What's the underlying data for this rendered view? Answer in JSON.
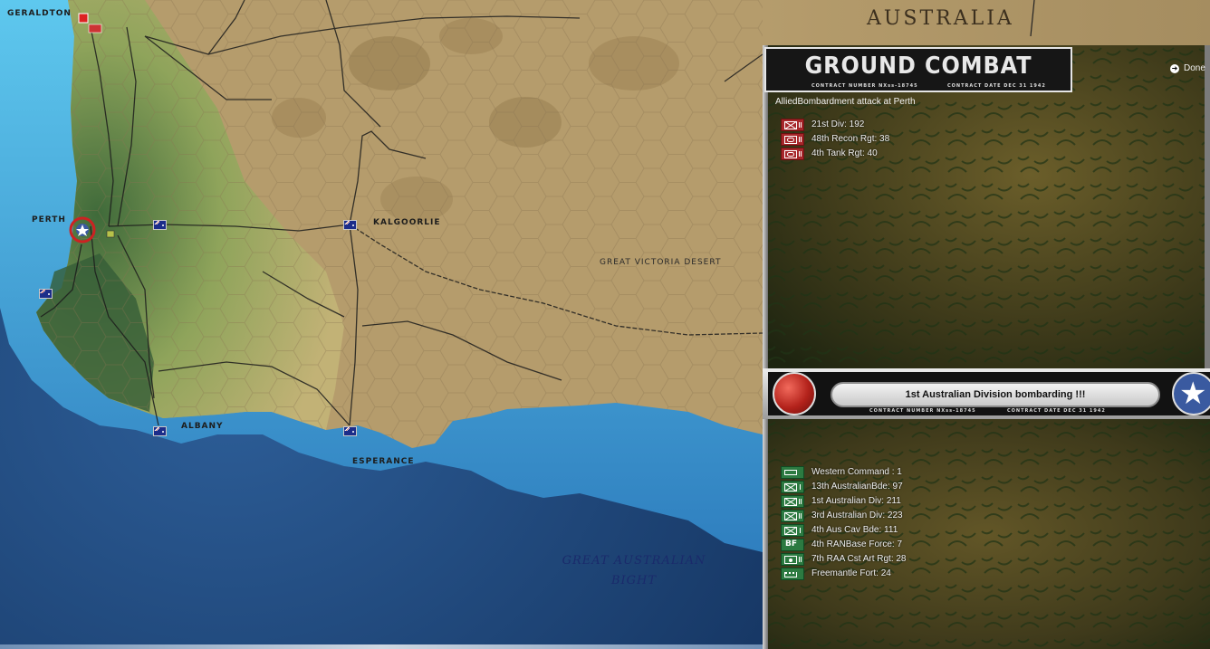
{
  "map": {
    "region_label": "AUSTRALIA",
    "places": {
      "geraldton": "GERALDTON",
      "perth": "PERTH",
      "kalgoorlie": "KALGOORLIE",
      "albany": "ALBANY",
      "esperance": "ESPERANCE",
      "desert": "GREAT VICTORIA DESERT"
    },
    "sea": {
      "line1": "GREAT AUSTRALIAN",
      "line2": "BIGHT"
    }
  },
  "combat_panel": {
    "title": "GROUND COMBAT",
    "contract_number": "CONTRACT NUMBER   NXss-18745",
    "contract_date": "CONTRACT DATE   DEC 31 1942",
    "done_label": "Done",
    "attack_text": "AlliedBombardment attack at Perth",
    "japanese_units": [
      {
        "icon": "infantry-division-icon",
        "label": "21st Div: 192"
      },
      {
        "icon": "recon-regiment-icon",
        "label": "48th Recon Rgt: 38"
      },
      {
        "icon": "tank-regiment-icon",
        "label": "4th Tank Rgt: 40"
      }
    ]
  },
  "result_panel": {
    "message": "1st Australian Division bombarding !!!",
    "contract_number": "CONTRACT NUMBER   NXss-18745",
    "contract_date": "CONTRACT DATE   DEC 31 1942",
    "allied_units": [
      {
        "icon": "hq-command-icon",
        "label": "Western Command : 1"
      },
      {
        "icon": "infantry-brigade-icon",
        "label": "13th AustralianBde: 97"
      },
      {
        "icon": "infantry-division-icon",
        "label": "1st Australian Div: 211"
      },
      {
        "icon": "infantry-division-icon",
        "label": "3rd Australian Div: 223"
      },
      {
        "icon": "cavalry-brigade-icon",
        "label": "4th Aus Cav Bde: 111"
      },
      {
        "icon": "base-force-icon",
        "label": "4th RANBase Force: 7",
        "symbol": "BF"
      },
      {
        "icon": "coastal-artillery-icon",
        "label": "7th RAA Cst Art Rgt: 28"
      },
      {
        "icon": "fort-icon",
        "label": "Freemantle Fort: 24"
      }
    ]
  },
  "colors": {
    "japanese_unit": "#a6262a",
    "allied_unit": "#2c7a41",
    "ocean": "#1b3f6d",
    "desert": "#b49a6a"
  }
}
